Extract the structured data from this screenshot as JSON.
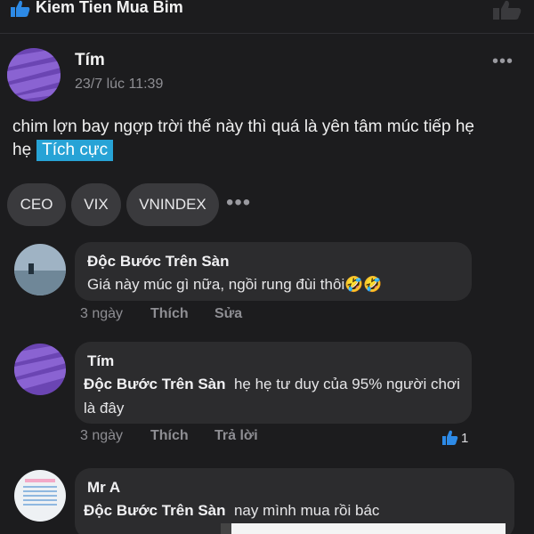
{
  "header": {
    "title": "Kiem Tien Mua Bim",
    "icons": [
      "thumbs-up-icon",
      "thumbs-up-outline-icon"
    ]
  },
  "post": {
    "author": "Tím",
    "time": "23/7 lúc 11:39",
    "more": "•••",
    "body": "chim lợn bay ngợp trời thế này thì quá là yên tâm múc tiếp hẹ hẹ",
    "sentiment": "Tích cực",
    "tags": [
      "CEO",
      "VIX",
      "VNINDEX"
    ],
    "tags_more": "•••"
  },
  "comments": [
    {
      "author": "Độc Bước Trên Sàn",
      "text": "Giá này múc gì nữa, ngồi rung đùi thôi🤣🤣",
      "time": "3 ngày",
      "like_label": "Thích",
      "action_label": "Sửa"
    },
    {
      "author": "Tím",
      "mention": "Độc Bước Trên Sàn",
      "text": "hẹ hẹ tư duy của 95% người chơi là đây",
      "time": "3 ngày",
      "like_label": "Thích",
      "action_label": "Trả lời",
      "likes": "1"
    },
    {
      "author": "Mr A",
      "mention": "Độc Bước Trên Sàn",
      "text": "nay mình mua rồi bác"
    }
  ],
  "colors": {
    "background": "#1c1c1e",
    "bubble": "#2c2c2e",
    "sentiment_badge": "#27a3d6",
    "like_icon": "#2d8ae6"
  }
}
